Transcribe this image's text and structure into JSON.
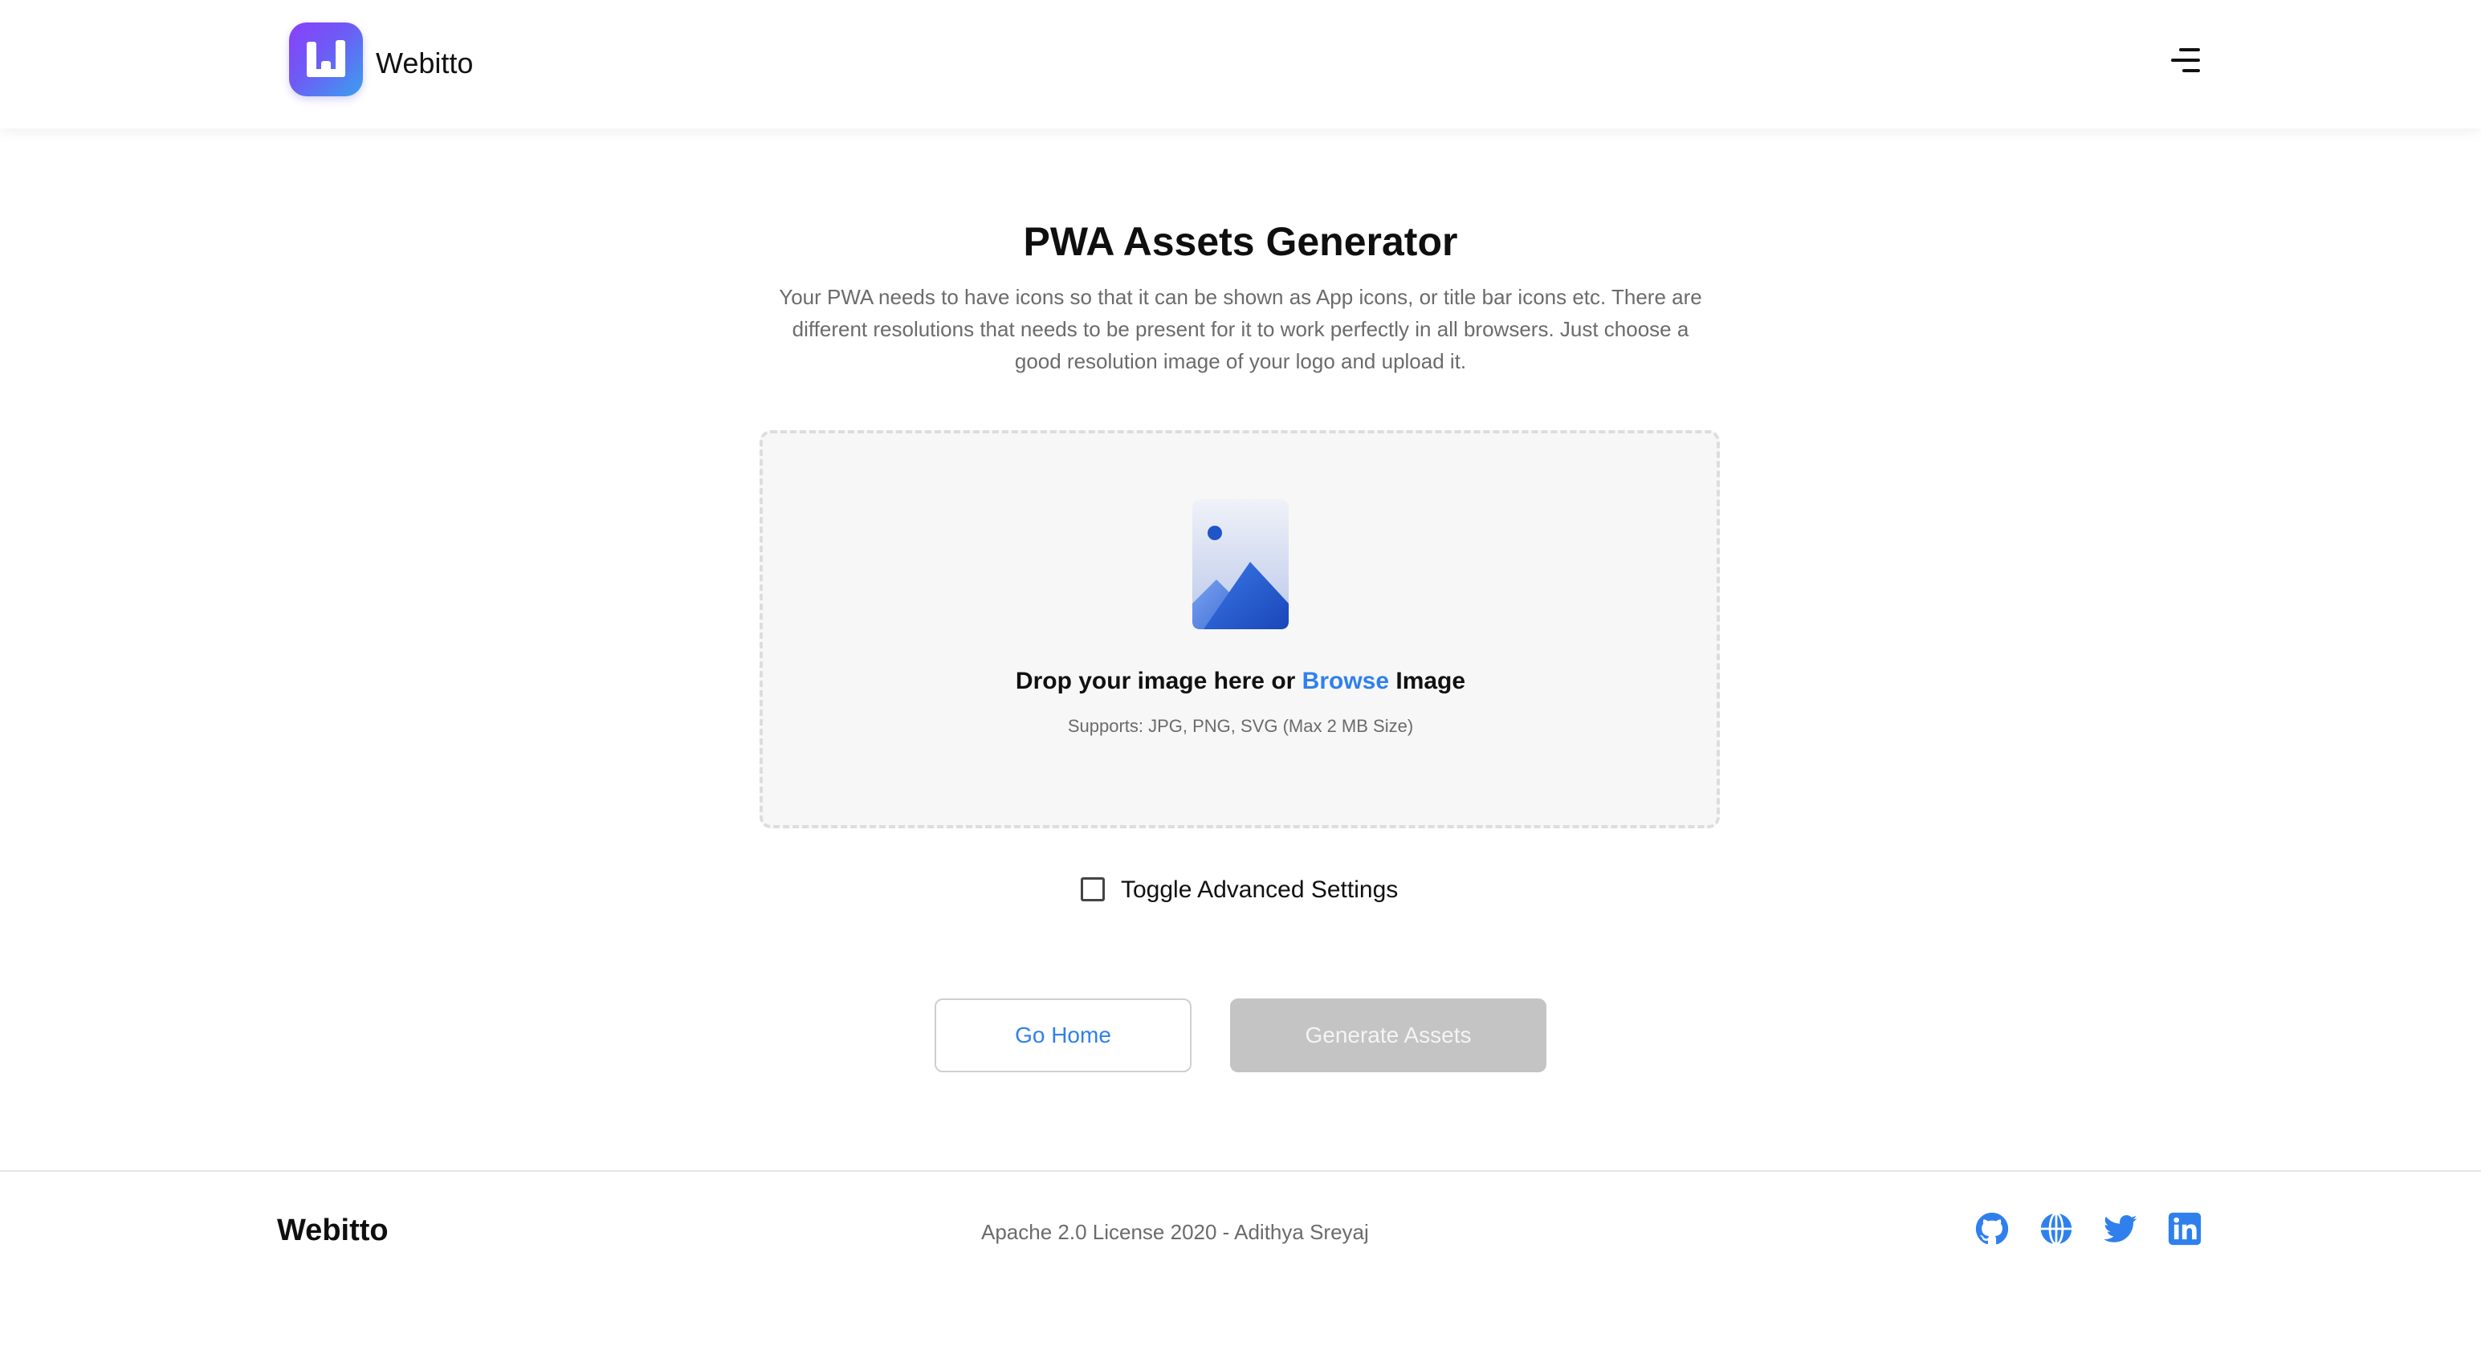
{
  "header": {
    "brand": "Webitto",
    "menu_icon": "menu-icon",
    "logo_icon": "bar-chart-logo-icon"
  },
  "main": {
    "title": "PWA Assets Generator",
    "description": "Your PWA needs to have icons so that it can be shown as App icons, or title bar icons etc. There are different resolutions that needs to be present for it to work perfectly in all browsers. Just choose a good resolution image of your logo and upload it.",
    "dropzone": {
      "icon": "image-icon",
      "text_before": "Drop your image here or ",
      "browse_label": "Browse",
      "text_after": " Image",
      "supports": "Supports: JPG, PNG, SVG (Max 2 MB Size)"
    },
    "advanced_toggle": {
      "label": "Toggle Advanced Settings",
      "checked": false
    },
    "buttons": {
      "home": "Go Home",
      "generate": "Generate Assets",
      "generate_disabled": true
    }
  },
  "footer": {
    "brand": "Webitto",
    "license": "Apache 2.0 License 2020 - Adithya Sreyaj",
    "social_icons": [
      "github-icon",
      "globe-icon",
      "twitter-icon",
      "linkedin-icon"
    ]
  },
  "colors": {
    "accent": "#2f80ed",
    "logo_gradient": [
      "#8a3ffc",
      "#3aa0f0"
    ],
    "disabled_button": "#c4c4c4"
  }
}
